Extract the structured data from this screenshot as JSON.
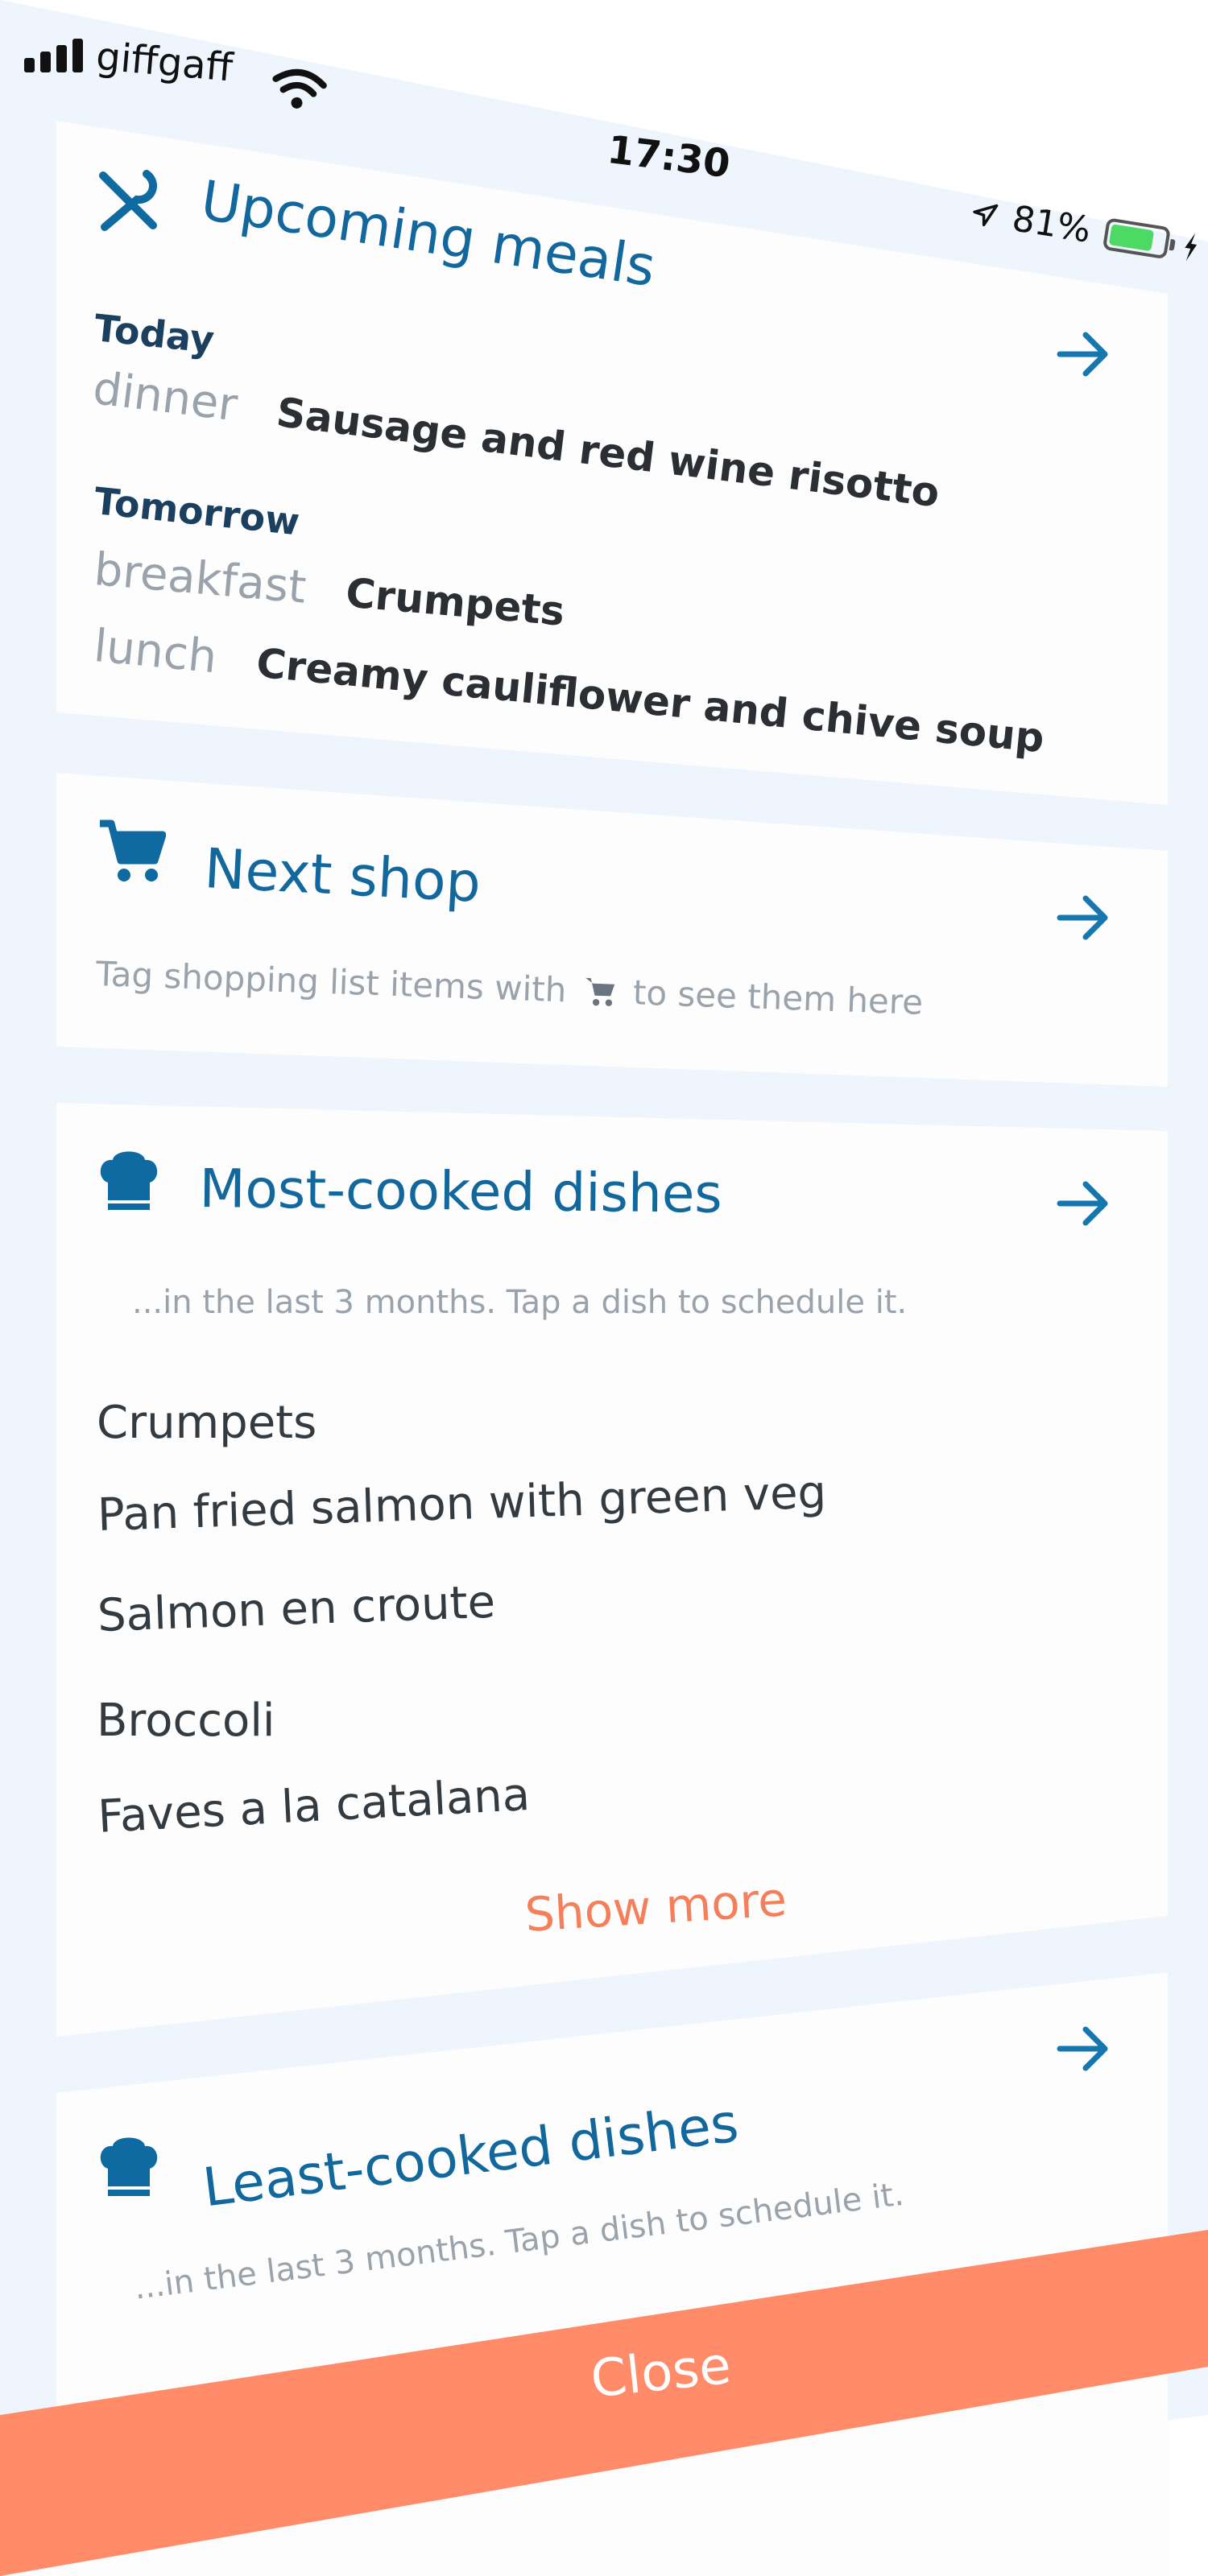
{
  "status_bar": {
    "carrier": "giffgaff",
    "time": "17:30",
    "battery_percent_label": "81%",
    "battery_level": 0.81,
    "battery_color": "#4cd964"
  },
  "cards": {
    "upcoming": {
      "icon": "cutlery-icon",
      "title": "Upcoming meals",
      "days": [
        {
          "label": "Today",
          "meals": [
            {
              "type": "dinner",
              "name": "Sausage and red wine risotto"
            }
          ]
        },
        {
          "label": "Tomorrow",
          "meals": [
            {
              "type": "breakfast",
              "name": "Crumpets"
            },
            {
              "type": "lunch",
              "name": "Creamy cauliflower and chive soup"
            }
          ]
        }
      ]
    },
    "next_shop": {
      "icon": "shopping-cart-icon",
      "title": "Next shop",
      "hint_before": "Tag shopping list items with",
      "hint_after": "to see them here"
    },
    "most_cooked": {
      "icon": "chef-hat-icon",
      "title": "Most-cooked dishes",
      "subtitle": "...in the last 3 months. Tap a dish to schedule it.",
      "dishes": [
        "Crumpets",
        "Pan fried salmon with green veg",
        "Salmon en croute",
        "Broccoli",
        "Faves a la catalana"
      ],
      "show_more": "Show more"
    },
    "least_cooked": {
      "icon": "chef-hat-icon",
      "title": "Least-cooked dishes",
      "subtitle": "...in the last 3 months. Tap a dish to schedule it."
    }
  },
  "close_button": {
    "label": "Close"
  },
  "colors": {
    "accent": "#12689c",
    "close_bar": "#ff8b68",
    "show_more": "#f57f5b",
    "background": "#eef5fc"
  }
}
